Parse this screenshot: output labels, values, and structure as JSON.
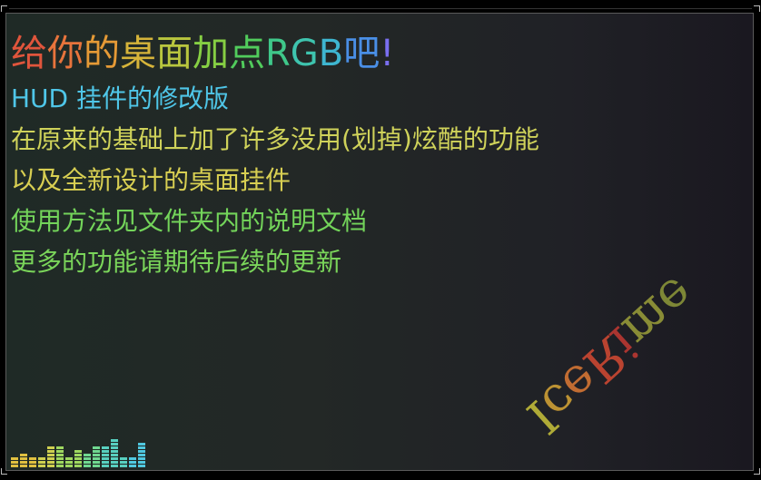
{
  "title": {
    "segments": [
      {
        "text": "给",
        "color": "#e0553c"
      },
      {
        "text": "你",
        "color": "#e8743c"
      },
      {
        "text": "的",
        "color": "#e59a36"
      },
      {
        "text": "桌",
        "color": "#d6b43a"
      },
      {
        "text": "面",
        "color": "#b9c63e"
      },
      {
        "text": "加",
        "color": "#86cf43"
      },
      {
        "text": "点",
        "color": "#51cc5c"
      },
      {
        "text": "R",
        "color": "#3fc88a"
      },
      {
        "text": "G",
        "color": "#3ec4ae"
      },
      {
        "text": "B",
        "color": "#3eb6d0"
      },
      {
        "text": "吧",
        "color": "#4a8fe6"
      },
      {
        "text": "!",
        "color": "#7a6ff0"
      }
    ]
  },
  "lines": {
    "subtitle": "HUD 挂件的修改版",
    "line1": "在原来的基础上加了许多没用(划掉)炫酷的功能",
    "line2": "以及全新设计的桌面挂件",
    "line3": "使用方法见文件夹内的说明文档",
    "line4": "更多的功能请期待后续的更新"
  },
  "watermark": {
    "letters": [
      {
        "text": "I",
        "color": "#c9c43a"
      },
      {
        "text": "c",
        "color": "#d8a636"
      },
      {
        "text": "e",
        "color": "#de7a35"
      },
      {
        "text": "R",
        "color": "#d64a33"
      },
      {
        "text": "i",
        "color": "#c43a33"
      },
      {
        "text": "m",
        "color": "#9ca03a"
      },
      {
        "text": "e",
        "color": "#8f9a3a"
      }
    ]
  },
  "visualizer": {
    "bar_levels": [
      0.3,
      0.4,
      0.25,
      0.3,
      0.5,
      0.55,
      0.3,
      0.45,
      0.4,
      0.5,
      0.55,
      0.7,
      0.3,
      0.25,
      0.65
    ],
    "colors": [
      "#e0c040",
      "#cfd050",
      "#9ed860",
      "#70d890",
      "#58d0c0",
      "#50c8e0"
    ]
  }
}
